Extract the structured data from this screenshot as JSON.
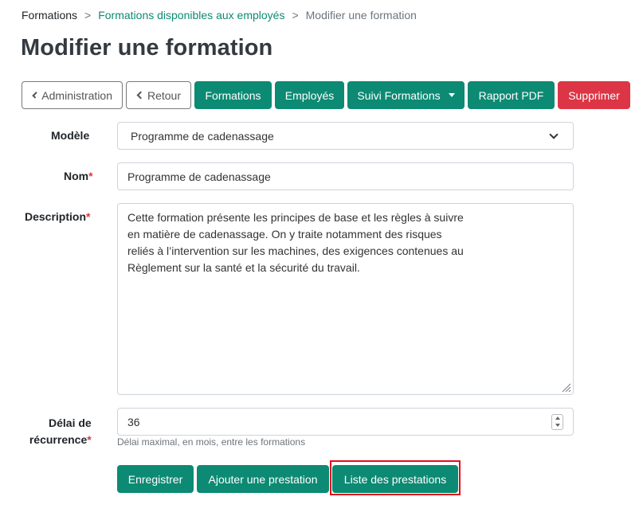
{
  "breadcrumb": {
    "home": "Formations",
    "separator": ">",
    "link": "Formations disponibles aux employés",
    "current": "Modifier une formation"
  },
  "page": {
    "title": "Modifier une formation"
  },
  "toolbar": {
    "administration": "Administration",
    "retour": "Retour",
    "formations": "Formations",
    "employes": "Employés",
    "suivi": "Suivi Formations",
    "rapport": "Rapport PDF",
    "supprimer": "Supprimer"
  },
  "form": {
    "modele": {
      "label": "Modèle",
      "value": "Programme de cadenassage"
    },
    "nom": {
      "label": "Nom",
      "required": "*",
      "value": "Programme de cadenassage"
    },
    "description": {
      "label": "Description",
      "required": "*",
      "lines": [
        "Cette formation présente les principes de base et les règles à suivre",
        "en matière de cadenassage. On y traite notamment des risques",
        "reliés à l’intervention sur les machines, des exigences contenues au",
        "Règlement sur la santé et la sécurité du travail."
      ]
    },
    "delai": {
      "label_line1": "Délai de",
      "label_line2": "récurrence",
      "required": "*",
      "value": "36",
      "help": "Délai maximal, en mois, entre les formations"
    }
  },
  "actions": {
    "enregistrer": "Enregistrer",
    "ajouter": "Ajouter une prestation",
    "liste": "Liste des prestations"
  },
  "colors": {
    "primary": "#0c8a73",
    "danger": "#dc3545",
    "highlight": "#e0101c"
  }
}
